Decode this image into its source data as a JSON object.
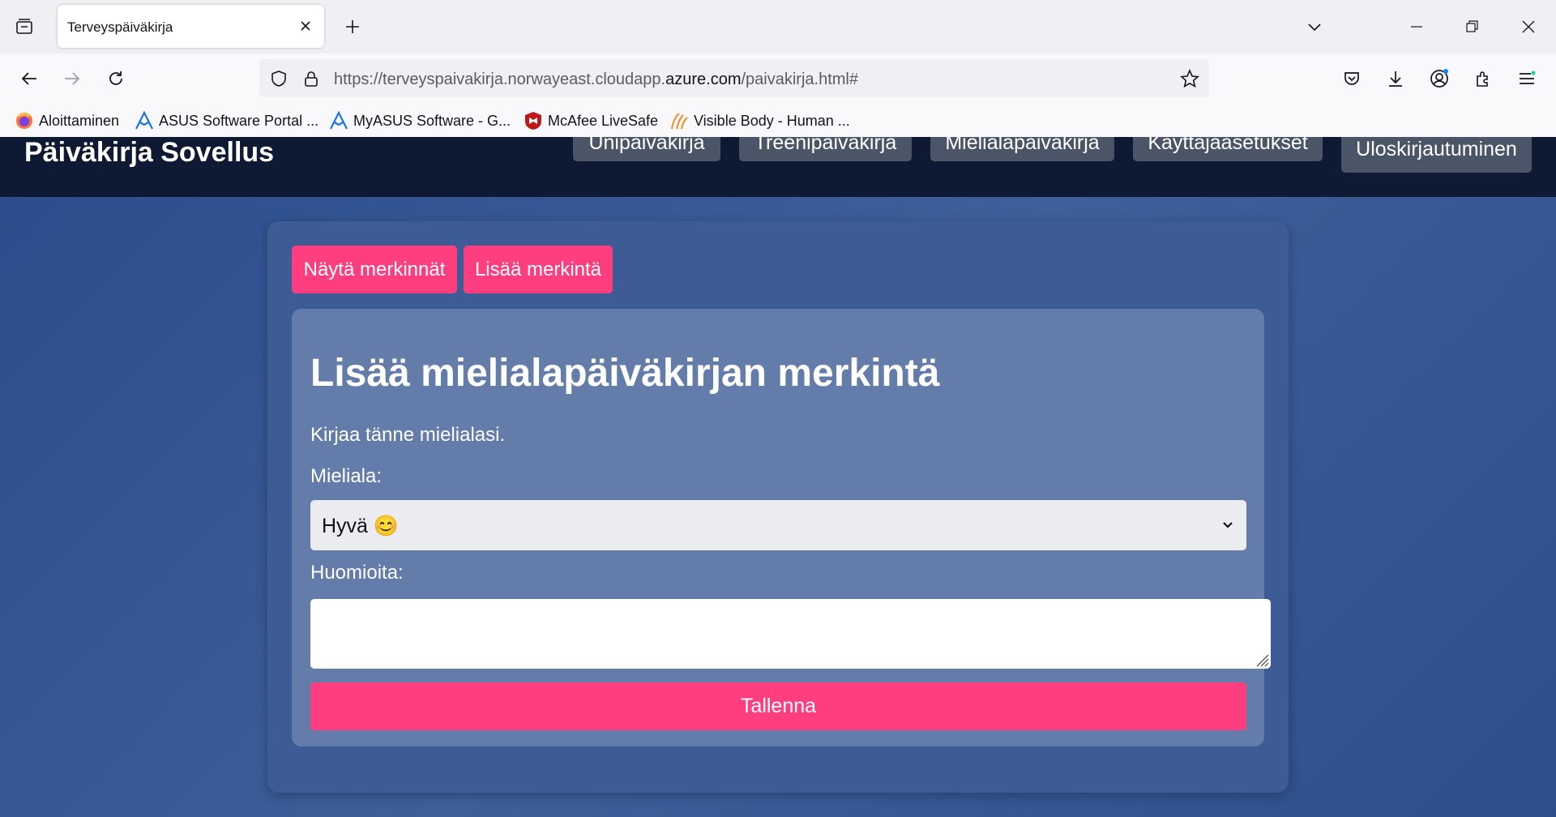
{
  "browser": {
    "tab_title": "Terveyspäiväkirja",
    "url_prefix": "https://terveyspaivakirja.norwayeast.cloudapp.",
    "url_domain": "azure.com",
    "url_suffix": "/paivakirja.html#",
    "bookmarks": [
      {
        "label": "Aloittaminen",
        "icon": "firefox-icon"
      },
      {
        "label": "ASUS Software Portal ...",
        "icon": "asus-icon"
      },
      {
        "label": "MyASUS Software - G...",
        "icon": "asus-icon"
      },
      {
        "label": "McAfee LiveSafe",
        "icon": "mcafee-icon"
      },
      {
        "label": "Visible Body - Human ...",
        "icon": "visible-body-icon"
      }
    ]
  },
  "site": {
    "title": "Päiväkirja Sovellus",
    "nav": [
      "Unipäiväkirja",
      "Treenipäiväkirja",
      "Mielialapäiväkirja",
      "Käyttäjäasetukset"
    ],
    "logout": "Uloskirjautuminen"
  },
  "card": {
    "show_entries": "Näytä merkinnät",
    "add_entry": "Lisää merkintä"
  },
  "form": {
    "title": "Lisää mielialapäiväkirjan merkintä",
    "intro": "Kirjaa tänne mielialasi.",
    "mood_label": "Mieliala:",
    "mood_value": "Hyvä 😊",
    "notes_label": "Huomioita:",
    "notes_value": "",
    "save": "Tallenna"
  },
  "colors": {
    "accent": "#ff3e7f",
    "header": "#0e1a33",
    "card": "#3d5c95",
    "panel": "#647ca9"
  }
}
